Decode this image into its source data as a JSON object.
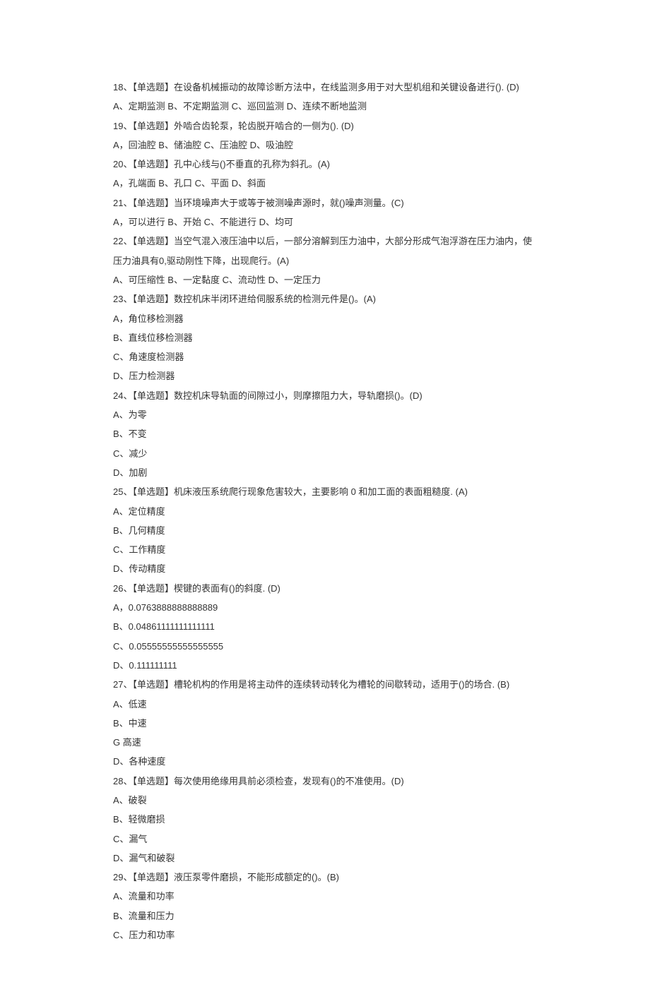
{
  "lines": [
    "18、【单选题】在设备机械振动的故障诊断方法中，在线监测多用于对大型机组和关键设备进行(). (D)",
    "A、定期监测 B、不定期监测 C、巡回监测 D、连续不断地监测",
    "19、【单选题】外啮合齿轮泵，轮齿脱开啮合的一侧为(). (D)",
    "A，回油腔 B、储油腔 C、压油腔 D、吸油腔",
    "20、【单选题】孔中心线与()不垂直的孔称为斜孔。(A)",
    "A，孔端面 B、孔口 C、平面 D、斜面",
    "21、【单选题】当环境噪声大于或等于被测噪声源时，就()噪声测量。(C)",
    "A，可以进行 B、开始 C、不能进行 D、均可",
    "22、【单选题】当空气混入液压油中以后，一部分溶解到压力油中，大部分形成气泡浮游在压力油内，使压力油具有0,驱动刚性下降，出现爬行。(A)",
    "A、可压缩性 B、一定黏度 C、流动性 D、一定压力",
    "23、【单选题】数控机床半闭环进给伺服系统的检测元件是()。(A)",
    "A，角位移检测器",
    "B、直线位移检测器",
    "C、角速度检测器",
    "D、压力检测器",
    "24、【单选题】数控机床导轨面的间隙过小，则摩擦阻力大，导轨磨损()。(D)",
    "A、为零",
    "B、不变",
    "C、减少",
    "D、加剧",
    "25、【单选题】机床液压系统爬行现象危害较大，主要影响 0 和加工面的表面粗糙度. (A)",
    "A、定位精度",
    "B、几何精度",
    "C、工作精度",
    "D、传动精度",
    "26、【单选题】楔键的表面有()的斜度. (D)",
    "A，0.0763888888888889",
    "B、0.04861111111111111",
    "C、0.05555555555555555",
    "D、0.111111111",
    "27、【单选题】槽轮机构的作用是将主动件的连续转动转化为槽轮的间歇转动，适用于()的场合. (B)",
    "A、低速",
    "B、中速",
    "G 高速",
    "D、各种速度",
    "28、【单选题】每次使用绝缘用具前必须检查，发现有()的不准使用。(D)",
    "A、破裂",
    "B、轻微磨损",
    "C、漏气",
    "D、漏气和破裂",
    "29、【单选题】液压泵零件磨损，不能形成额定的()。(B)",
    "A、流量和功率",
    "B、流量和压力",
    "C、压力和功率"
  ]
}
